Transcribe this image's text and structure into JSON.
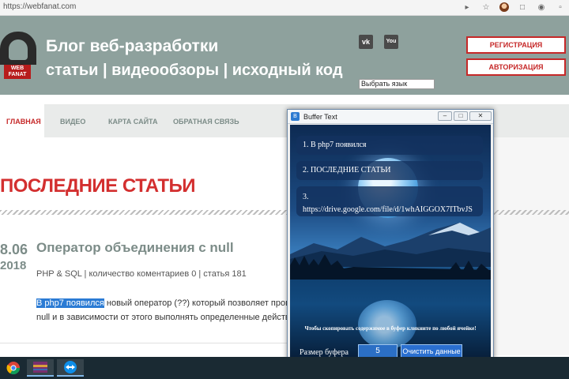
{
  "browser": {
    "url": "https://webfanat.com",
    "icons": [
      "cast-icon",
      "star-icon",
      "profile-icon",
      "extension-icon",
      "headphones-icon",
      "bookmark-icon"
    ]
  },
  "site": {
    "logo_text": "WEB FANAT",
    "title": "Блог веб-разработки",
    "subtitle": "статьи | видеообзоры | исходный код",
    "social": {
      "vk": "vk",
      "youtube": "You"
    },
    "language_select": "Выбрать язык",
    "register_button": "РЕГИСТРАЦИЯ",
    "login_button": "АВТОРИЗАЦИЯ"
  },
  "nav": {
    "items": [
      {
        "label": "ГЛАВНАЯ",
        "active": true
      },
      {
        "label": "ВИДЕО",
        "active": false
      },
      {
        "label": "КАРТА САЙТА",
        "active": false
      },
      {
        "label": "ОБРАТНАЯ СВЯЗЬ",
        "active": false
      }
    ]
  },
  "content": {
    "section_title": "ПОСЛЕДНИЕ СТАТЬИ",
    "post": {
      "date_day": "8.06",
      "date_year": "2018",
      "title": "Оператор объединения с null",
      "meta": "PHP & SQL | количество коментариев 0 | статья 181",
      "text_highlight": "В php7 появился",
      "text_rest": " новый оператор (??) который позволяет провер",
      "text_line2": "null и в зависимости от этого выполнять определенные действия"
    }
  },
  "buffer_window": {
    "title": "Buffer Text",
    "items": [
      "1. В php7 появился",
      "2. ПОСЛЕДНИЕ СТАТЬИ",
      "3.",
      "https://drive.google.com/file/d/1whAIGGOX7ITbvJS"
    ],
    "hint": "Чтобы скопировать содержимое в буфер кликните по любой ячейке!",
    "buffer_size_label": "Размер буфера",
    "buffer_size_value": "5",
    "clear_button": "Очистить данные"
  },
  "taskbar": {
    "apps": [
      "chrome-icon",
      "winrar-icon",
      "teamviewer-icon"
    ]
  }
}
